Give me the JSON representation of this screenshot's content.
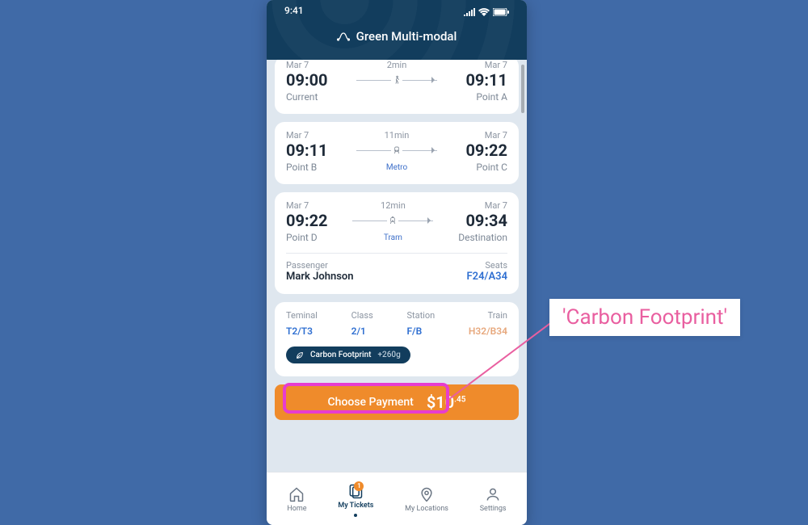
{
  "status": {
    "time": "9:41"
  },
  "header": {
    "title": "Green Multi-modal"
  },
  "legs": [
    {
      "depart_date": "Mar 7",
      "depart_time": "09:00",
      "depart_loc": "Current",
      "duration": "2min",
      "mode": "walk",
      "mode_label": "",
      "arrive_date": "Mar 7",
      "arrive_time": "09:11",
      "arrive_loc": "Point A"
    },
    {
      "depart_date": "Mar 7",
      "depart_time": "09:11",
      "depart_loc": "Point B",
      "duration": "11min",
      "mode": "metro",
      "mode_label": "Metro",
      "arrive_date": "Mar 7",
      "arrive_time": "09:22",
      "arrive_loc": "Point C"
    },
    {
      "depart_date": "Mar 7",
      "depart_time": "09:22",
      "depart_loc": "Point D",
      "duration": "12min",
      "mode": "tram",
      "mode_label": "Tram",
      "arrive_date": "Mar 7",
      "arrive_time": "09:34",
      "arrive_loc": "Destination"
    }
  ],
  "passenger": {
    "label": "Passenger",
    "name": "Mark Johnson",
    "seats_label": "Seats",
    "seats": "F24/A34"
  },
  "details": [
    {
      "label": "Teminal",
      "value": "T2/T3"
    },
    {
      "label": "Class",
      "value": "2/1"
    },
    {
      "label": "Station",
      "value": "F/B"
    },
    {
      "label": "Train",
      "value": "H32/B34"
    }
  ],
  "carbon": {
    "label": "Carbon Footprint",
    "value": "+260g"
  },
  "cta": {
    "label": "Choose Payment",
    "price_main": "10",
    "price_cents": ".45",
    "currency": "$"
  },
  "tabs": [
    {
      "id": "home",
      "label": "Home"
    },
    {
      "id": "tickets",
      "label": "My Tickets",
      "badge": "1",
      "active": true
    },
    {
      "id": "locations",
      "label": "My Locations"
    },
    {
      "id": "settings",
      "label": "Settings"
    }
  ],
  "callout": {
    "text": "'Carbon Footprint'"
  },
  "colors": {
    "brand": "#123d5d",
    "accent": "#ef8b2b",
    "link": "#2f6fd1",
    "highlight": "#e73ccf",
    "callout": "#e95fa0"
  }
}
